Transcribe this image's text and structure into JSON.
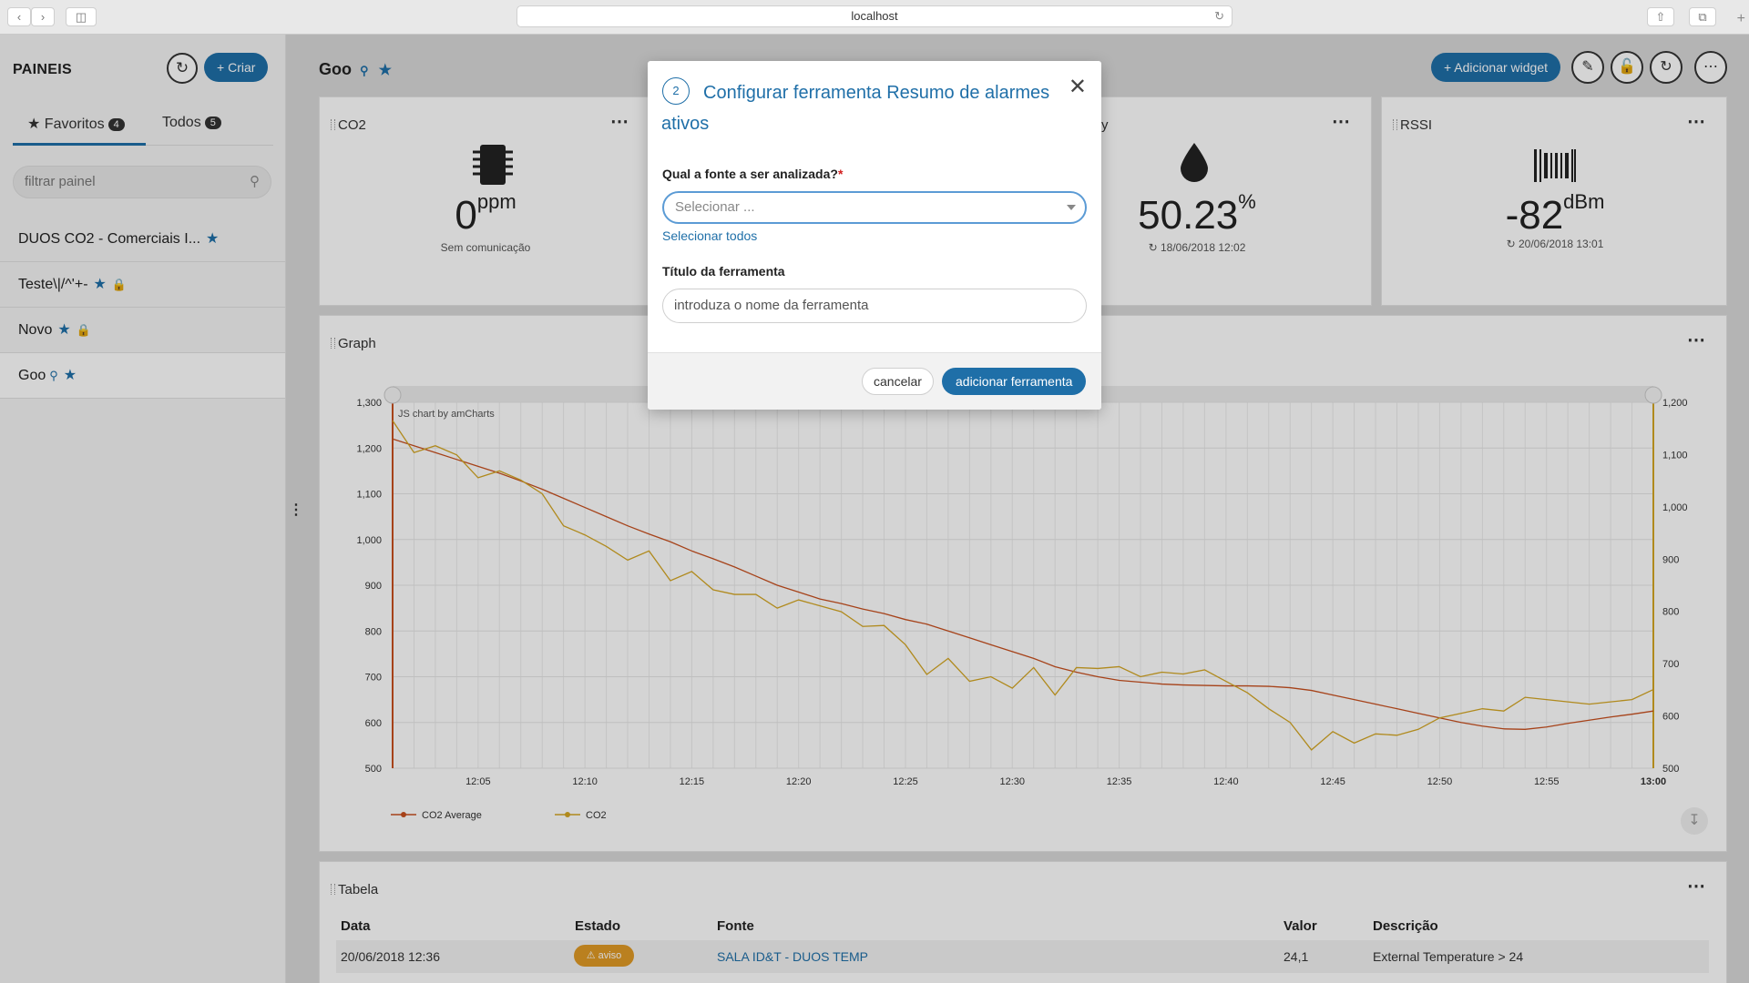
{
  "browser": {
    "url": "localhost"
  },
  "sidebar": {
    "title": "PAINEIS",
    "create_label": "Criar",
    "tabs": [
      {
        "label": "Favoritos",
        "count": "4"
      },
      {
        "label": "Todos",
        "count": "5"
      }
    ],
    "filter_placeholder": "filtrar painel",
    "items": [
      {
        "label": "DUOS CO2 - Comerciais I..."
      },
      {
        "label": "Teste\\|/^'+-"
      },
      {
        "label": "Novo"
      },
      {
        "label": "Goo"
      }
    ]
  },
  "dashboard": {
    "title": "Goo",
    "add_widget_label": "Adicionar widget"
  },
  "widgets": {
    "co2": {
      "title": "CO2",
      "value": "0",
      "unit": "ppm",
      "status": "Sem comunicação"
    },
    "humidity": {
      "title_fragment": "y",
      "value": "50.23",
      "unit": "%",
      "timestamp": "18/06/2018 12:02"
    },
    "rssi": {
      "title": "RSSI",
      "value": "-82",
      "unit": "dBm",
      "timestamp": "20/06/2018 13:01"
    },
    "graph": {
      "title": "Graph",
      "credit": "JS chart by amCharts"
    },
    "table": {
      "title": "Tabela"
    }
  },
  "chart_data": {
    "type": "line",
    "x": [
      "12:01",
      "12:02",
      "12:03",
      "12:04",
      "12:05",
      "12:06",
      "12:07",
      "12:08",
      "12:09",
      "12:10",
      "12:11",
      "12:12",
      "12:13",
      "12:14",
      "12:15",
      "12:16",
      "12:17",
      "12:18",
      "12:19",
      "12:20",
      "12:21",
      "12:22",
      "12:23",
      "12:24",
      "12:25",
      "12:26",
      "12:27",
      "12:28",
      "12:29",
      "12:30",
      "12:31",
      "12:32",
      "12:33",
      "12:34",
      "12:35",
      "12:36",
      "12:37",
      "12:38",
      "12:39",
      "12:40",
      "12:41",
      "12:42",
      "12:43",
      "12:44",
      "12:45",
      "12:46",
      "12:47",
      "12:48",
      "12:49",
      "12:50",
      "12:51",
      "12:52",
      "12:53",
      "12:54",
      "12:55",
      "12:56",
      "12:57",
      "12:58",
      "12:59",
      "13:00"
    ],
    "x_ticks": [
      "12:05",
      "12:10",
      "12:15",
      "12:20",
      "12:25",
      "12:30",
      "12:35",
      "12:40",
      "12:45",
      "12:50",
      "12:55",
      "13:00"
    ],
    "series": [
      {
        "name": "CO2 Average",
        "color": "#c8501f",
        "values": [
          1220,
          1205,
          1190,
          1175,
          1160,
          1145,
          1128,
          1110,
          1090,
          1070,
          1050,
          1030,
          1012,
          995,
          975,
          958,
          940,
          920,
          900,
          885,
          870,
          860,
          848,
          838,
          825,
          815,
          800,
          785,
          770,
          755,
          740,
          722,
          710,
          700,
          692,
          688,
          684,
          682,
          681,
          680,
          680,
          679,
          676,
          670,
          660,
          650,
          640,
          630,
          620,
          610,
          600,
          592,
          586,
          585,
          590,
          598,
          605,
          612,
          618,
          625
        ]
      },
      {
        "name": "CO2",
        "color": "#d4a623",
        "values": [
          1260,
          1190,
          1205,
          1185,
          1135,
          1150,
          1130,
          1100,
          1030,
          1010,
          985,
          955,
          975,
          910,
          930,
          890,
          880,
          880,
          850,
          868,
          855,
          842,
          810,
          812,
          770,
          705,
          740,
          690,
          700,
          675,
          720,
          660,
          720,
          718,
          722,
          700,
          710,
          706,
          715,
          690,
          665,
          630,
          600,
          540,
          580,
          555,
          575,
          572,
          585,
          610,
          620,
          630,
          625,
          655,
          650,
          645,
          640,
          645,
          650,
          672
        ]
      }
    ],
    "y_left": {
      "ticks": [
        "500",
        "600",
        "700",
        "800",
        "900",
        "1,000",
        "1,100",
        "1,200",
        "1,300"
      ],
      "min": 500,
      "max": 1300
    },
    "y_right": {
      "ticks": [
        "500",
        "600",
        "700",
        "800",
        "900",
        "1,000",
        "1,100",
        "1,200"
      ],
      "min": 500,
      "max": 1200
    },
    "legend": "bottom-left",
    "grid": true
  },
  "table": {
    "headers": [
      "Data",
      "Estado",
      "Fonte",
      "Valor",
      "Descrição"
    ],
    "rows": [
      {
        "data": "20/06/2018 12:36",
        "estado": "aviso",
        "fonte": "SALA ID&T - DUOS TEMP",
        "valor": "24,1",
        "descricao": "External Temperature > 24"
      }
    ]
  },
  "modal": {
    "step": "2",
    "title": "Configurar ferramenta Resumo de alarmes ativos",
    "source_label": "Qual a fonte a ser analizada?",
    "required_mark": "*",
    "select_placeholder": "Selecionar ...",
    "select_all": "Selecionar todos",
    "name_label": "Título da ferramenta",
    "name_placeholder": "introduza o nome da ferramenta",
    "cancel": "cancelar",
    "submit": "adicionar ferramenta"
  }
}
